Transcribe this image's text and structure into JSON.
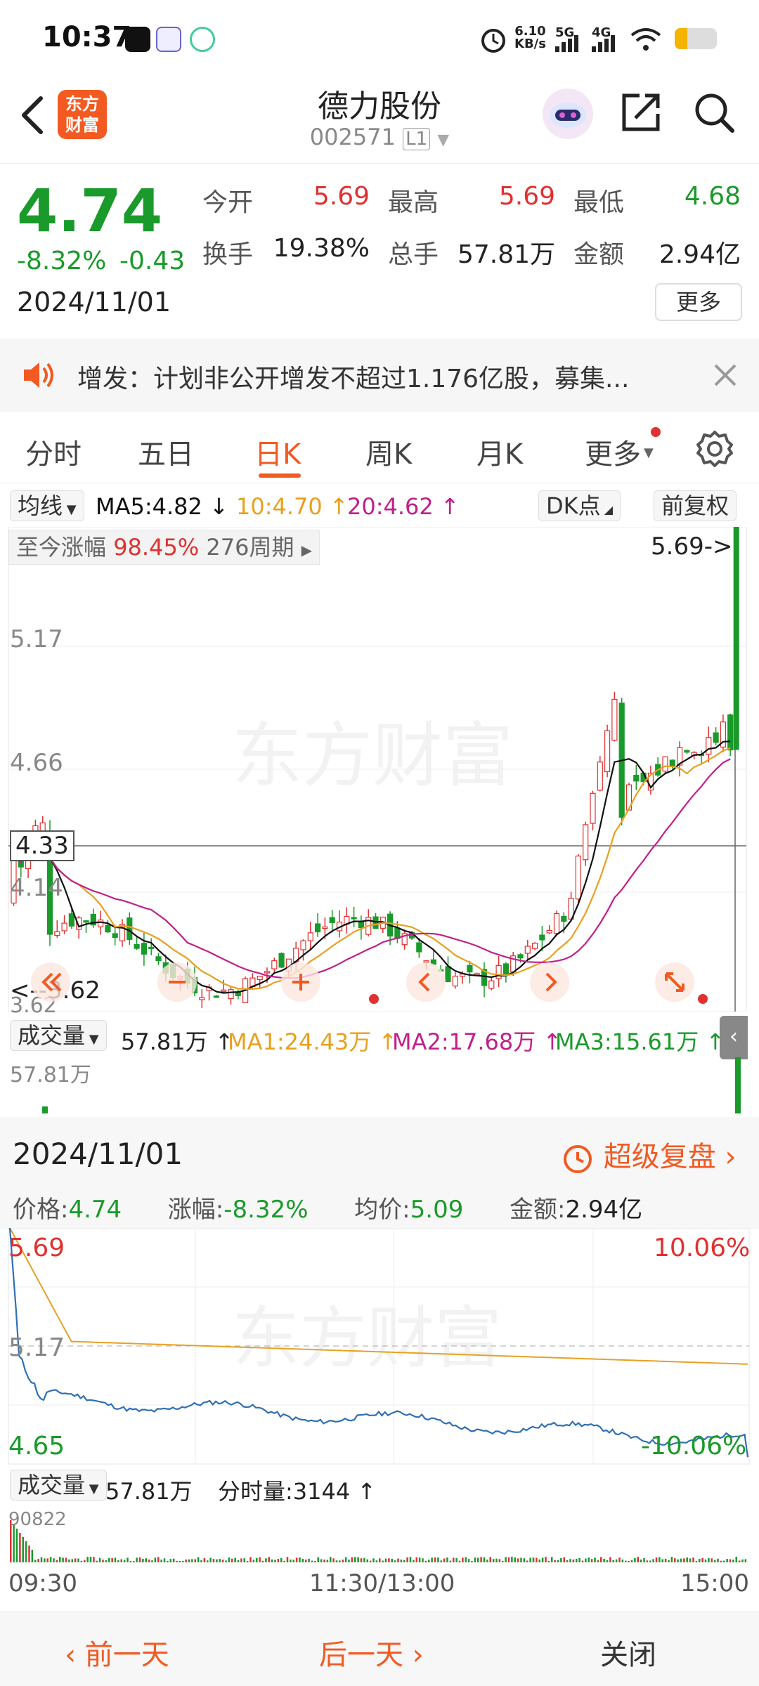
{
  "status_bar": {
    "time": "10:37",
    "net_speed_value": "6.10",
    "net_speed_unit": "KB/s",
    "sig1": "5G",
    "sig2": "4G",
    "battery_level": 0.3
  },
  "header": {
    "back_icon": "chevron-left-icon",
    "app_logo_line1": "东方",
    "app_logo_line2": "财富",
    "stock_name": "德力股份",
    "stock_code": "002571",
    "level_badge": "L1",
    "assistant_icon": "robot-icon",
    "share_icon": "share-icon",
    "search_icon": "search-icon"
  },
  "quote": {
    "price": "4.74",
    "change_pct": "-8.32%",
    "change_abs": "-0.43",
    "date": "2024/11/01",
    "open_label": "今开",
    "open": "5.69",
    "high_label": "最高",
    "high": "5.69",
    "low_label": "最低",
    "low": "4.68",
    "turnover_label": "换手",
    "turnover": "19.38%",
    "volume_label": "总手",
    "volume": "57.81万",
    "amount_label": "金额",
    "amount": "2.94亿",
    "more_label": "更多"
  },
  "notice": {
    "text": "增发：计划非公开增发不超过1.176亿股，募集...",
    "speaker_icon": "speaker-icon",
    "close_icon": "close-icon"
  },
  "tabs": [
    {
      "label": "分时"
    },
    {
      "label": "五日"
    },
    {
      "label": "日K"
    },
    {
      "label": "周K"
    },
    {
      "label": "月K"
    },
    {
      "label": "更多"
    }
  ],
  "settings_icon": "gear-icon",
  "ma_row": {
    "selector": "均线",
    "ma5": "MA5:4.82",
    "ma10": "10:4.70",
    "ma20": "20:4.62",
    "dk_label": "DK点",
    "adjust_label": "前复权"
  },
  "kline": {
    "gain_label": "至今涨幅",
    "gain_value": "98.45%",
    "period_label": "276周期",
    "top_marker": "5.69->",
    "price_labels": [
      "5.17",
      "4.66",
      "4.14",
      "3.62"
    ],
    "crosshair_price": "4.33",
    "low_marker": "<--3.62",
    "colors": {
      "up": "#e03131",
      "down": "#1a9a2a",
      "ma5": "#111111",
      "ma10": "#e8a020",
      "ma20": "#c0208a"
    }
  },
  "chart_controls": [
    "rewind-icon",
    "zoom-out-icon",
    "zoom-in-icon",
    "prev-icon",
    "next-icon",
    "fullscreen-icon"
  ],
  "volume_row": {
    "selector": "成交量",
    "vol": "57.81万",
    "ma1": "MA1:24.43万",
    "ma2": "MA2:17.68万",
    "ma3": "MA3:15.61万",
    "max_label": "57.81万"
  },
  "day_panel": {
    "date": "2024/11/01",
    "replay_label": "超级复盘",
    "price_label": "价格:",
    "price": "4.74",
    "change_label": "涨幅:",
    "change": "-8.32%",
    "avg_label": "均价:",
    "avg": "5.09",
    "amount_label": "金额:",
    "amount": "2.94亿"
  },
  "intraday": {
    "top_price": "5.69",
    "mid_price": "5.17",
    "bottom_price": "4.65",
    "top_pct": "10.06%",
    "bottom_pct": "-10.06%",
    "vol_selector": "成交量",
    "vol_total": "57.81万",
    "tick_label": "分时量:3144",
    "vol_max": "90822",
    "times": [
      "09:30",
      "11:30/13:00",
      "15:00"
    ]
  },
  "bottom_nav": {
    "prev": "前一天",
    "next": "后一天",
    "close": "关闭"
  },
  "watermark": "东方财富"
}
